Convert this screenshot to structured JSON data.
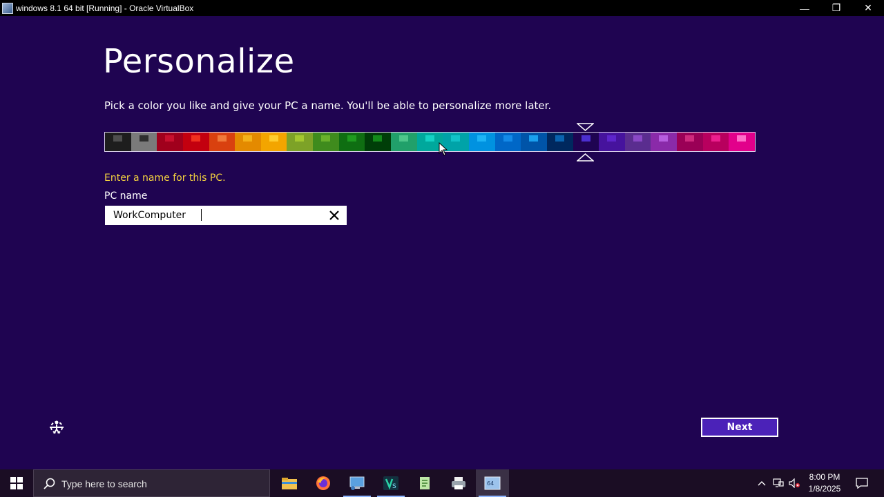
{
  "window": {
    "title": "windows 8.1 64 bit [Running] - Oracle VirtualBox",
    "minimize_glyph": "—",
    "restore_glyph": "❐",
    "close_glyph": "✕"
  },
  "setup": {
    "title": "Personalize",
    "subtitle": "Pick a color you like and give your PC a name. You'll be able to personalize more later.",
    "name_prompt": "Enter a name for this PC.",
    "field_label": "PC name",
    "pc_name_value": "WorkComputer",
    "next_label": "Next",
    "selected_swatch_index": 18
  },
  "swatches": [
    {
      "bg": "#1d1d1d",
      "accent": "#4e4e4e"
    },
    {
      "bg": "#7a7a7a",
      "accent": "#2f2f2f"
    },
    {
      "bg": "#a0001c",
      "accent": "#c8102e"
    },
    {
      "bg": "#c3000f",
      "accent": "#f0301f"
    },
    {
      "bg": "#d9410f",
      "accent": "#f07a3a"
    },
    {
      "bg": "#e48a00",
      "accent": "#f5b21a"
    },
    {
      "bg": "#f3a500",
      "accent": "#ffcd2f"
    },
    {
      "bg": "#7da227",
      "accent": "#a4c82f"
    },
    {
      "bg": "#3f8b1d",
      "accent": "#6ab12b"
    },
    {
      "bg": "#0f6e12",
      "accent": "#1f9b1f"
    },
    {
      "bg": "#003e08",
      "accent": "#138a1a"
    },
    {
      "bg": "#21a06a",
      "accent": "#4ec68b"
    },
    {
      "bg": "#00a89c",
      "accent": "#14d2c4"
    },
    {
      "bg": "#00a3a8",
      "accent": "#11c2c8"
    },
    {
      "bg": "#0092e0",
      "accent": "#1db4f5"
    },
    {
      "bg": "#0067c7",
      "accent": "#138ae8"
    },
    {
      "bg": "#0054a8",
      "accent": "#1aa0ef"
    },
    {
      "bg": "#00285e",
      "accent": "#0a64b0"
    },
    {
      "bg": "#1f0451",
      "accent": "#4c2fd0"
    },
    {
      "bg": "#46139d",
      "accent": "#5d25cb"
    },
    {
      "bg": "#5a2d8f",
      "accent": "#8a48c6"
    },
    {
      "bg": "#8a2aa9",
      "accent": "#b75ee0"
    },
    {
      "bg": "#9a0056",
      "accent": "#cf2a7d"
    },
    {
      "bg": "#b8005e",
      "accent": "#ec1f8e"
    },
    {
      "bg": "#e2008b",
      "accent": "#ff6fc9"
    }
  ],
  "taskbar": {
    "search_placeholder": "Type here to search",
    "apps": [
      "file-explorer",
      "firefox",
      "remote-desktop",
      "visual-studio",
      "notepad-plus",
      "printer-app",
      "virtualbox"
    ],
    "time": "8:00 PM",
    "date": "1/8/2025"
  }
}
